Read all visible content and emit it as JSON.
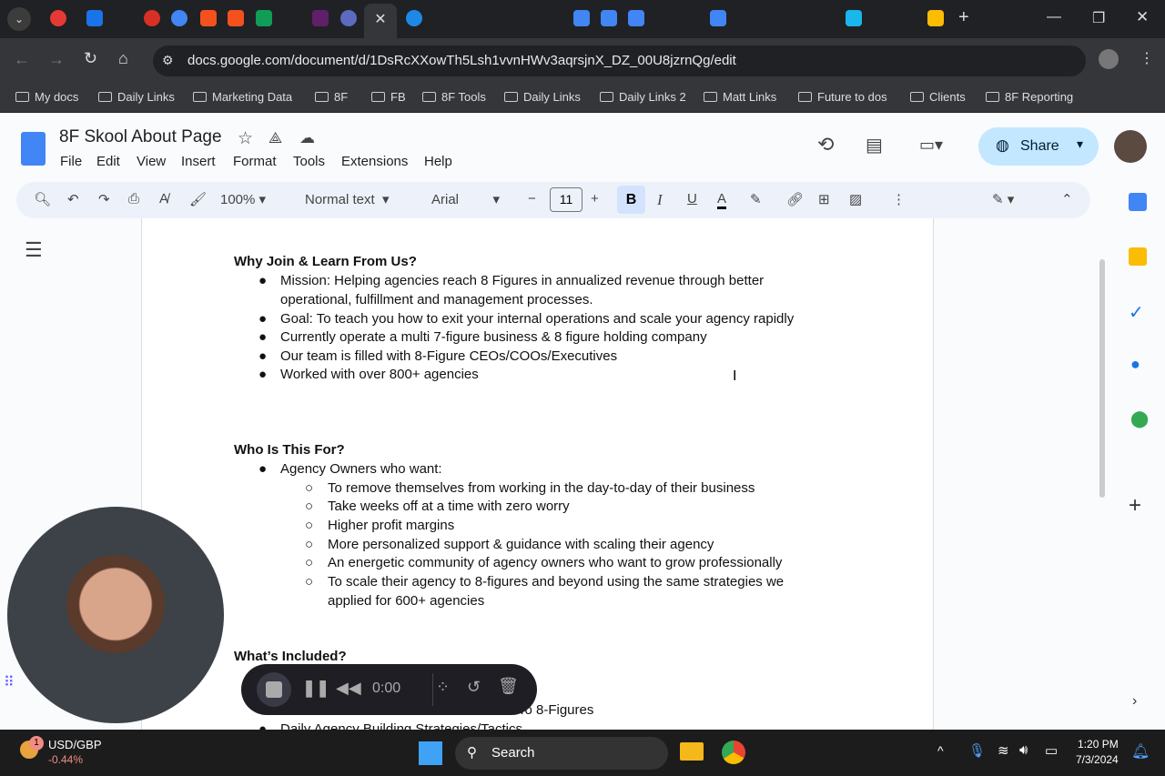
{
  "browser": {
    "url": "docs.google.com/document/d/1DsRcXXowTh5Lsh1vvnHWv3aqrsjnX_DZ_00U8jzrnQg/edit",
    "bookmarks": [
      "My docs",
      "Daily Links",
      "Marketing Data",
      "8F",
      "FB",
      "8F Tools",
      "Daily Links",
      "Daily Links 2",
      "Matt Links",
      "Future to dos",
      "Clients",
      "8F Reporting"
    ]
  },
  "docs": {
    "title": "8F Skool About Page",
    "menu": [
      "File",
      "Edit",
      "View",
      "Insert",
      "Format",
      "Tools",
      "Extensions",
      "Help"
    ],
    "toolbar": {
      "zoom": "100%",
      "style": "Normal text",
      "font": "Arial",
      "size": "11"
    },
    "share": "Share"
  },
  "content": {
    "s1": {
      "heading": "Why Join & Learn From Us?",
      "items": [
        "Mission: Helping agencies reach 8 Figures in annualized revenue through better",
        "operational, fulfillment and management processes.",
        "Goal: To teach you how to exit your internal operations and scale your agency rapidly",
        "Currently operate a multi 7-figure business & 8 figure holding company",
        "Our team is filled with 8-Figure CEOs/COOs/Executives",
        "Worked with over 800+ agencies"
      ]
    },
    "s2": {
      "heading": "Who Is This For?",
      "item": "Agency Owners who want:",
      "sub": [
        "To remove themselves from working in the day-to-day of their business",
        "Take weeks off at a time with zero worry",
        "Higher profit margins",
        "More personalized support & guidance with scaling their agency",
        "An energetic community of agency owners who want to grow professionally",
        "To scale their agency to 8-figures and beyond using the same strategies we",
        "applied for 600+ agencies"
      ]
    },
    "s3": {
      "heading": "What’s Included?",
      "items": [
        "To 8-Figures",
        "Daily Agency Building Strategies/Tactics"
      ]
    }
  },
  "recorder": {
    "time": "0:00"
  },
  "taskbar": {
    "ticker": "USD/GBP",
    "change": "-0.44%",
    "badge": "1",
    "search": "Search",
    "time": "1:20 PM",
    "date": "7/3/2024"
  }
}
